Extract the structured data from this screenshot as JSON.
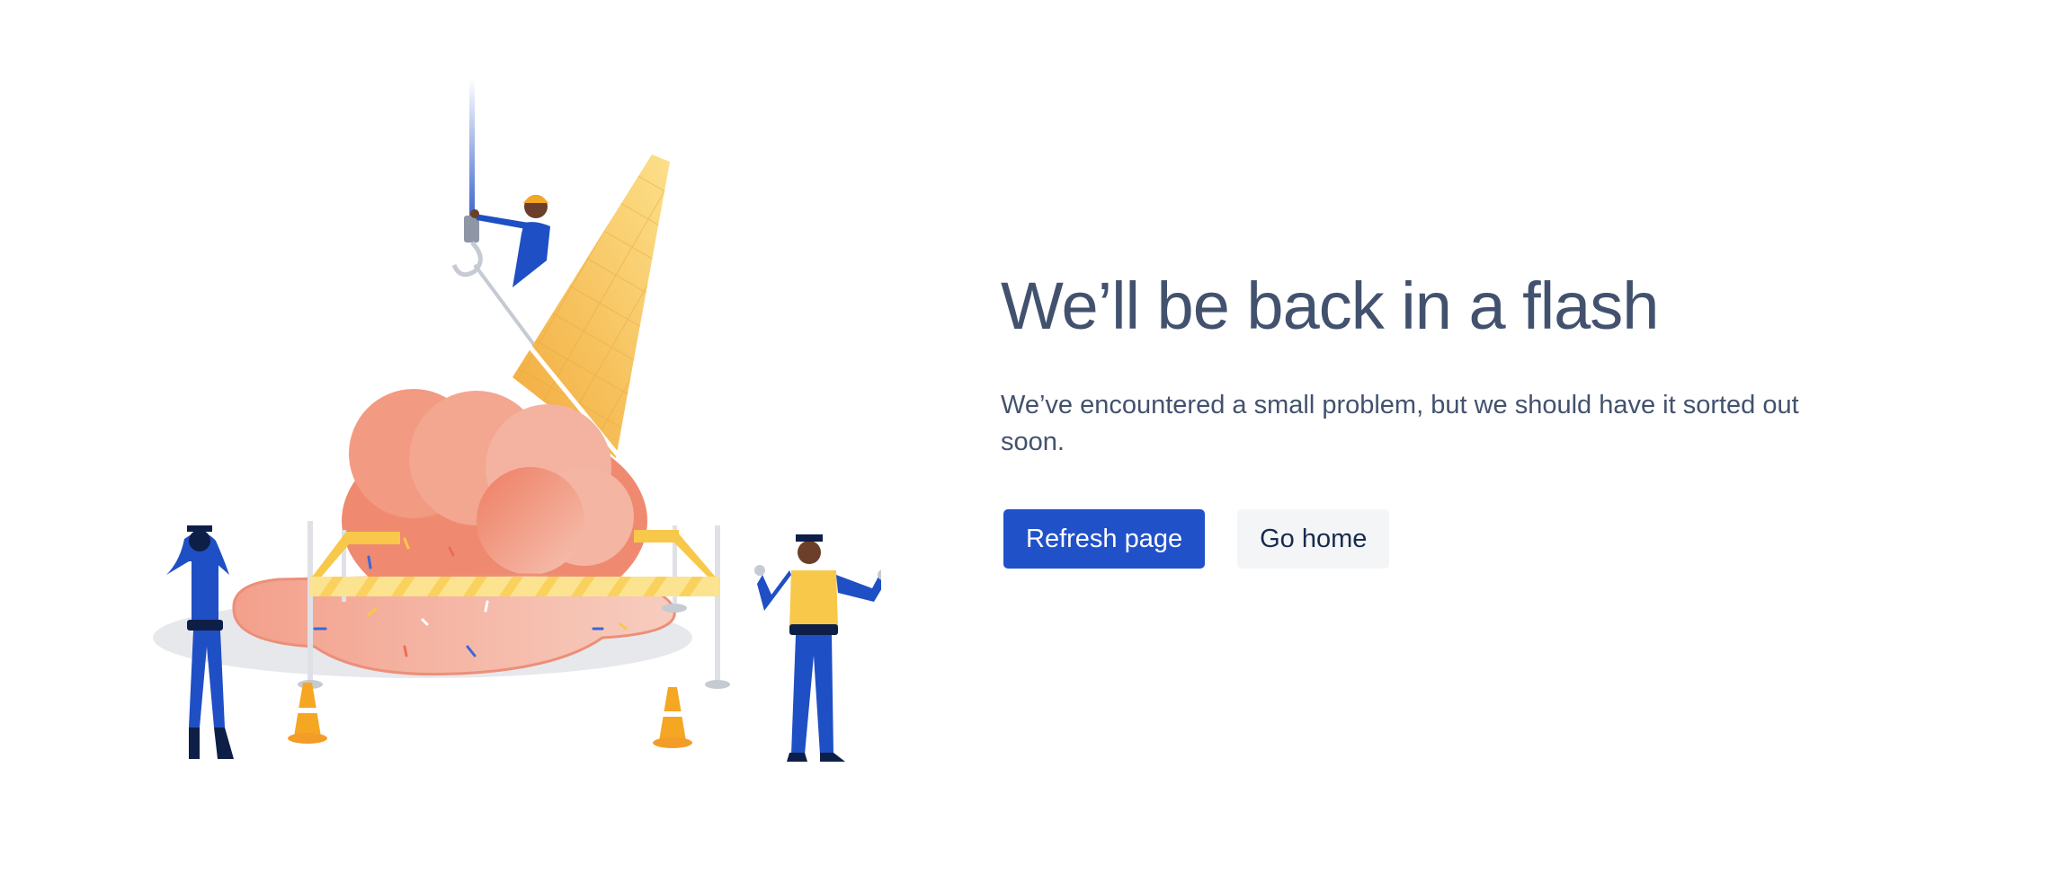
{
  "error": {
    "title": "We’ll be back in a flash",
    "message": "We’ve encountered a small problem, but we should have it sorted out soon."
  },
  "actions": {
    "refresh_label": "Refresh page",
    "home_label": "Go home"
  },
  "colors": {
    "heading": "#42526e",
    "primary": "#2151c9",
    "secondary_bg": "#f4f5f7",
    "cone": "#f7c94a",
    "ice_cream": "#f0937a",
    "uniform": "#1f4fc4"
  }
}
